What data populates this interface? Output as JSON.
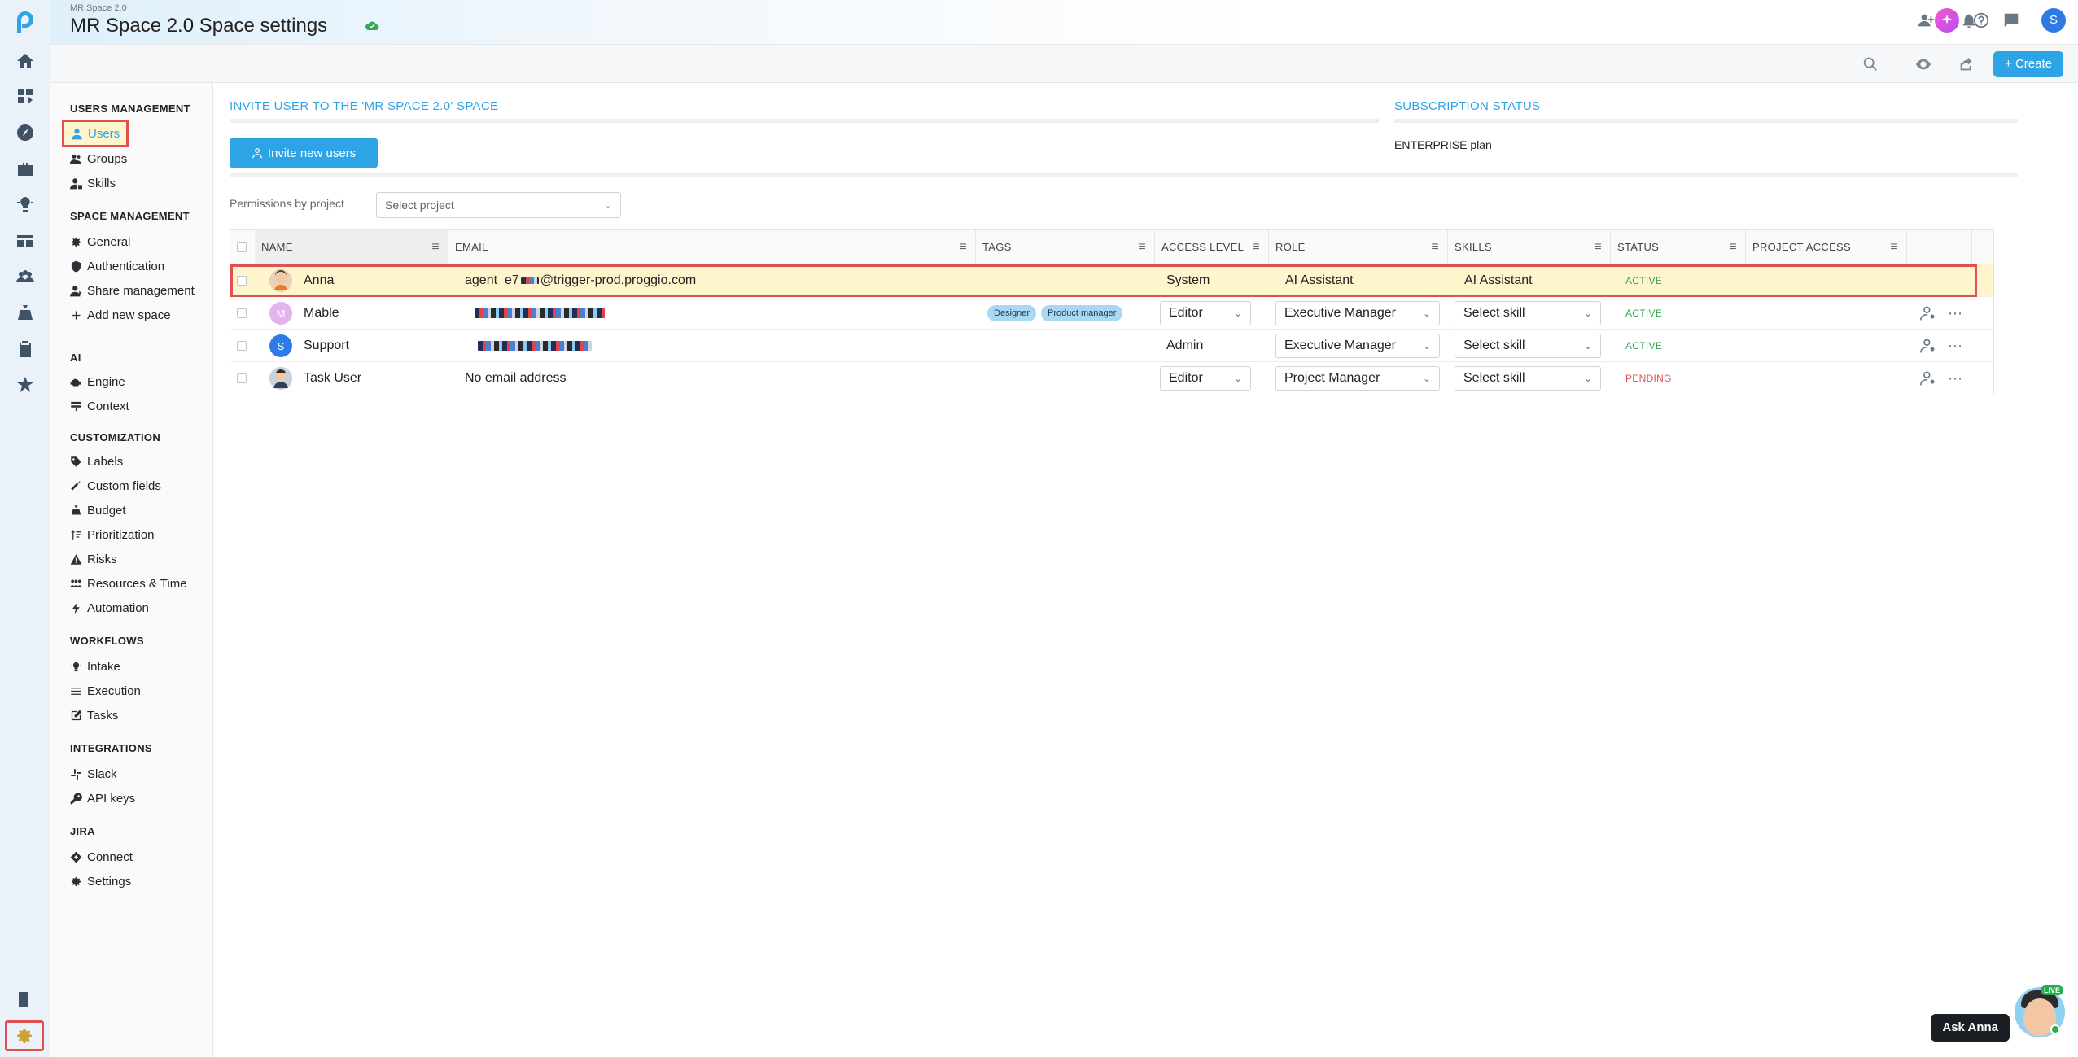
{
  "header": {
    "breadcrumb": "MR Space 2.0",
    "title": "MR Space 2.0 Space settings",
    "avatar_initial": "S"
  },
  "toolbar": {
    "create_label": "+ Create"
  },
  "sidebar": {
    "sections": [
      {
        "title": "USERS MANAGEMENT",
        "items": [
          "Users",
          "Groups",
          "Skills"
        ]
      },
      {
        "title": "SPACE MANAGEMENT",
        "items": [
          "General",
          "Authentication",
          "Share management",
          "Add new space"
        ]
      },
      {
        "title": "AI",
        "items": [
          "Engine",
          "Context"
        ]
      },
      {
        "title": "CUSTOMIZATION",
        "items": [
          "Labels",
          "Custom fields",
          "Budget",
          "Prioritization",
          "Risks",
          "Resources & Time",
          "Automation"
        ]
      },
      {
        "title": "WORKFLOWS",
        "items": [
          "Intake",
          "Execution",
          "Tasks"
        ]
      },
      {
        "title": "INTEGRATIONS",
        "items": [
          "Slack",
          "API keys"
        ]
      },
      {
        "title": "JIRA",
        "items": [
          "Connect",
          "Settings"
        ]
      }
    ]
  },
  "main": {
    "invite_title": "INVITE USER TO THE 'MR SPACE 2.0' SPACE",
    "subscription_title": "SUBSCRIPTION STATUS",
    "plan": "ENTERPRISE plan",
    "invite_button": "Invite new users",
    "permissions_label": "Permissions by project",
    "select_project_placeholder": "Select project"
  },
  "table": {
    "columns": [
      "NAME",
      "EMAIL",
      "TAGS",
      "ACCESS LEVEL",
      "ROLE",
      "SKILLS",
      "STATUS",
      "PROJECT ACCESS"
    ],
    "rows": [
      {
        "name": "Anna",
        "email_prefix": "agent_e7",
        "email_suffix": "@trigger-prod.proggio.com",
        "tags": [],
        "access": "System",
        "role": "AI Assistant",
        "skills": "AI Assistant",
        "status": "ACTIVE"
      },
      {
        "name": "Mable",
        "avatar_initial": "M",
        "email": "",
        "tags": [
          "Designer",
          "Product manager"
        ],
        "access": "Editor",
        "role": "Executive Manager",
        "skills": "Select skill",
        "status": "ACTIVE"
      },
      {
        "name": "Support",
        "avatar_initial": "S",
        "email": "",
        "tags": [],
        "access": "Admin",
        "role": "Executive Manager",
        "skills": "Select skill",
        "status": "ACTIVE"
      },
      {
        "name": "Task User",
        "email": "No email address",
        "tags": [],
        "access": "Editor",
        "role": "Project Manager",
        "skills": "Select skill",
        "status": "PENDING"
      }
    ]
  },
  "assistant": {
    "label": "Ask Anna",
    "live_badge": "LIVE"
  },
  "colors": {
    "accent": "#2ea3e6",
    "active_status": "#3aa655",
    "pending_status": "#e05050",
    "highlight": "#e05050"
  }
}
